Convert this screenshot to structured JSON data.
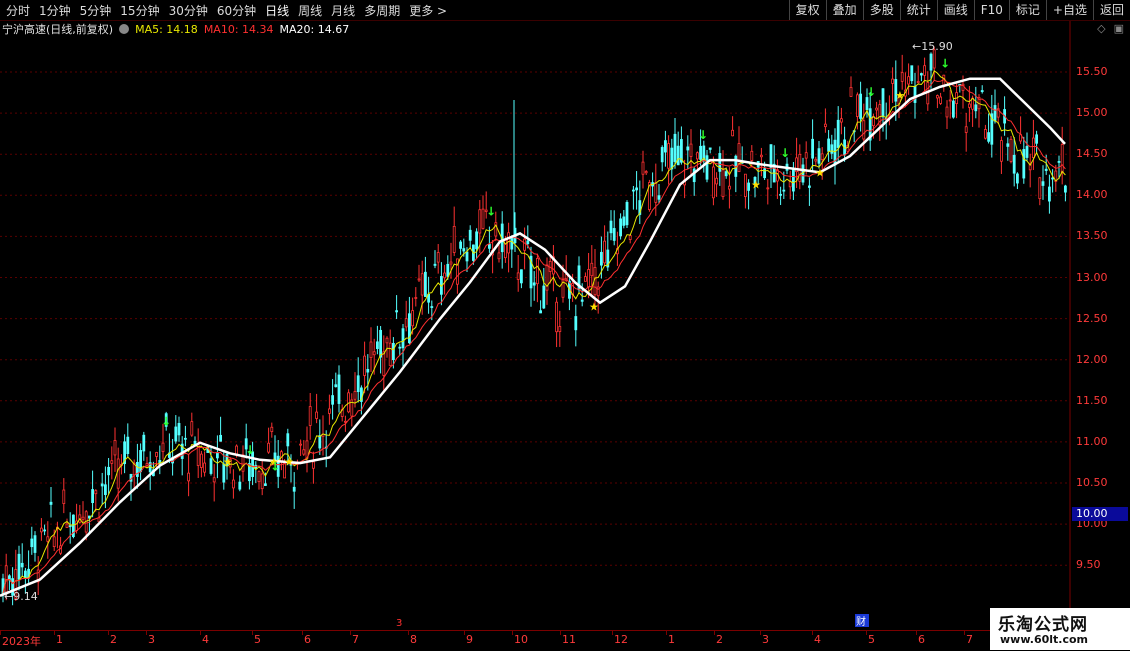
{
  "toolbar": {
    "periods": [
      "分时",
      "1分钟",
      "5分钟",
      "15分钟",
      "30分钟",
      "60分钟",
      "日线",
      "周线",
      "月线",
      "多周期",
      "更多 >"
    ],
    "active": "日线",
    "right_buttons": [
      "复权",
      "叠加",
      "多股",
      "统计",
      "画线",
      "F10",
      "标记",
      "+自选",
      "返回"
    ]
  },
  "legend": {
    "title": "宁沪高速(日线,前复权)",
    "ma5": "MA5: 14.18",
    "ma10": "MA10: 14.34",
    "ma20": "MA20: 14.67"
  },
  "price_axis": {
    "ticks": [
      "15.50",
      "15.00",
      "14.50",
      "14.00",
      "13.50",
      "13.00",
      "12.50",
      "12.00",
      "11.50",
      "11.00",
      "10.50",
      "10.00",
      "9.50"
    ],
    "current": "10.00"
  },
  "annotations": {
    "high": "15.90",
    "low": "9.14",
    "marker_red": "3",
    "marker_blue": "财"
  },
  "time_axis": {
    "labels": [
      "2023年",
      "1",
      "2",
      "3",
      "4",
      "5",
      "6",
      "7",
      "8",
      "9",
      "10",
      "11",
      "12",
      "1",
      "2",
      "3",
      "4",
      "5",
      "6",
      "7"
    ]
  },
  "chart_data": {
    "type": "candlestick",
    "y_range": [
      9.0,
      16.0
    ],
    "series": [
      {
        "name": "MA5",
        "color": "#e8e800"
      },
      {
        "name": "MA10",
        "color": "#ff3030"
      },
      {
        "name": "MA20",
        "color": "#ffffff"
      }
    ],
    "ma20_path": [
      [
        0,
        9.15
      ],
      [
        40,
        9.35
      ],
      [
        80,
        9.8
      ],
      [
        120,
        10.3
      ],
      [
        160,
        10.75
      ],
      [
        200,
        11.03
      ],
      [
        230,
        10.9
      ],
      [
        260,
        10.82
      ],
      [
        300,
        10.78
      ],
      [
        330,
        10.85
      ],
      [
        360,
        11.3
      ],
      [
        400,
        11.9
      ],
      [
        440,
        12.55
      ],
      [
        470,
        13.0
      ],
      [
        500,
        13.5
      ],
      [
        520,
        13.6
      ],
      [
        545,
        13.4
      ],
      [
        575,
        13.0
      ],
      [
        600,
        12.75
      ],
      [
        625,
        12.95
      ],
      [
        650,
        13.5
      ],
      [
        680,
        14.2
      ],
      [
        710,
        14.5
      ],
      [
        735,
        14.5
      ],
      [
        760,
        14.45
      ],
      [
        790,
        14.4
      ],
      [
        820,
        14.35
      ],
      [
        850,
        14.55
      ],
      [
        880,
        14.9
      ],
      [
        910,
        15.25
      ],
      [
        940,
        15.4
      ],
      [
        970,
        15.5
      ],
      [
        1000,
        15.5
      ],
      [
        1025,
        15.2
      ],
      [
        1050,
        14.9
      ],
      [
        1065,
        14.7
      ]
    ],
    "watermark": [
      "乐淘公式网",
      "www.60lt.com"
    ]
  }
}
